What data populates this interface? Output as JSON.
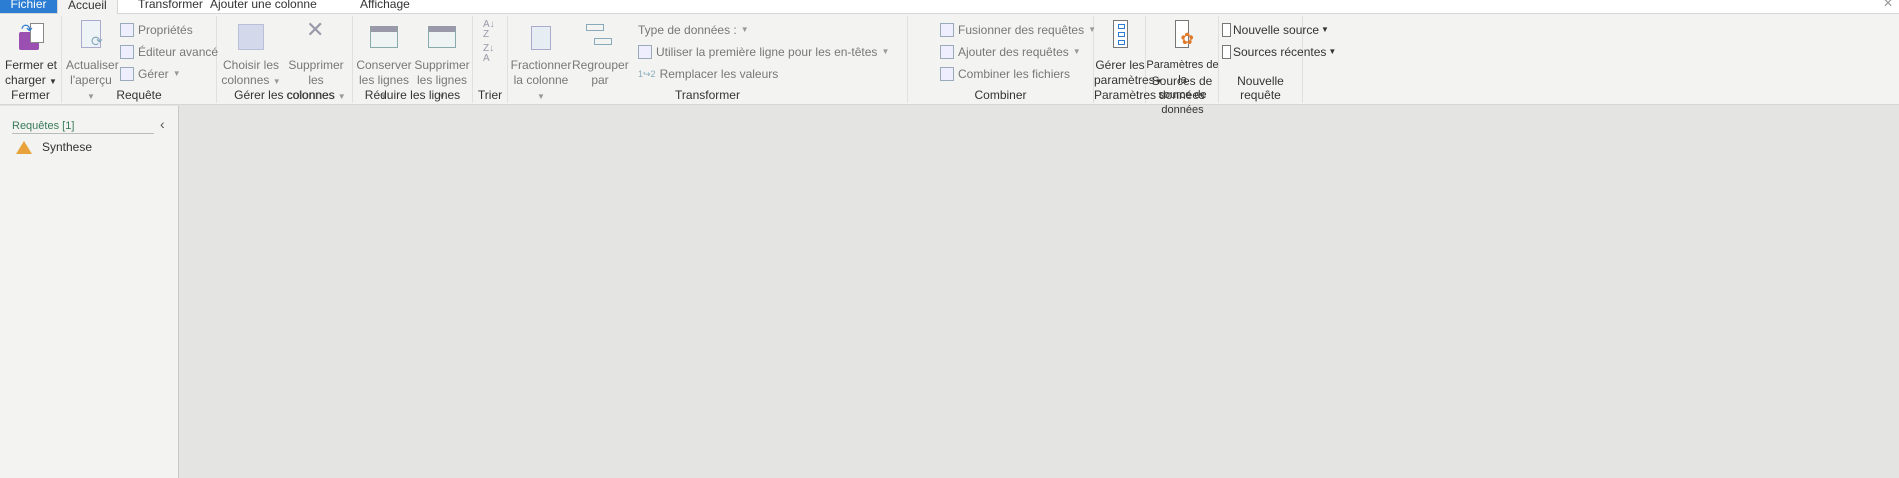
{
  "tabs": [
    "Fichier",
    "Accueil",
    "Transformer",
    "Ajouter une colonne",
    "Affichage"
  ],
  "ribbon": {
    "fermer": {
      "button": [
        "Fermer et",
        "charger"
      ],
      "label": "Fermer"
    },
    "requete": {
      "refresh": [
        "Actualiser",
        "l'aperçu"
      ],
      "properties": "Propriétés",
      "advanced_editor": "Éditeur avancé",
      "manage": "Gérer",
      "label": "Requête"
    },
    "colonnes": {
      "choose": [
        "Choisir les",
        "colonnes"
      ],
      "remove": [
        "Supprimer les",
        "colonnes"
      ],
      "label": "Gérer les colonnes"
    },
    "lignes": {
      "keep": [
        "Conserver",
        "les lignes"
      ],
      "remove": [
        "Supprimer",
        "les lignes"
      ],
      "label": "Réduire les lignes"
    },
    "trier": {
      "label": "Trier"
    },
    "transformer": {
      "split": [
        "Fractionner",
        "la colonne"
      ],
      "group": [
        "Regrouper",
        "par"
      ],
      "data_type": "Type de données :",
      "first_row": "Utiliser la première ligne pour les en-têtes",
      "replace": "Remplacer les valeurs",
      "label": "Transformer"
    },
    "combiner": {
      "merge": "Fusionner des requêtes",
      "append": "Ajouter des requêtes",
      "combine": "Combiner les fichiers",
      "label": "Combiner"
    },
    "parametres": {
      "manage": [
        "Gérer les",
        "paramètres"
      ],
      "label": "Paramètres"
    },
    "sources": {
      "settings": [
        "Paramètres de la",
        "source de données"
      ],
      "label": "Sources de données"
    },
    "nouvelle": {
      "new_source": "Nouvelle source",
      "recent": "Sources récentes",
      "label": "Nouvelle requête"
    }
  },
  "sidebar": {
    "header": "Requêtes [1]",
    "queries": [
      "Synthese"
    ]
  }
}
